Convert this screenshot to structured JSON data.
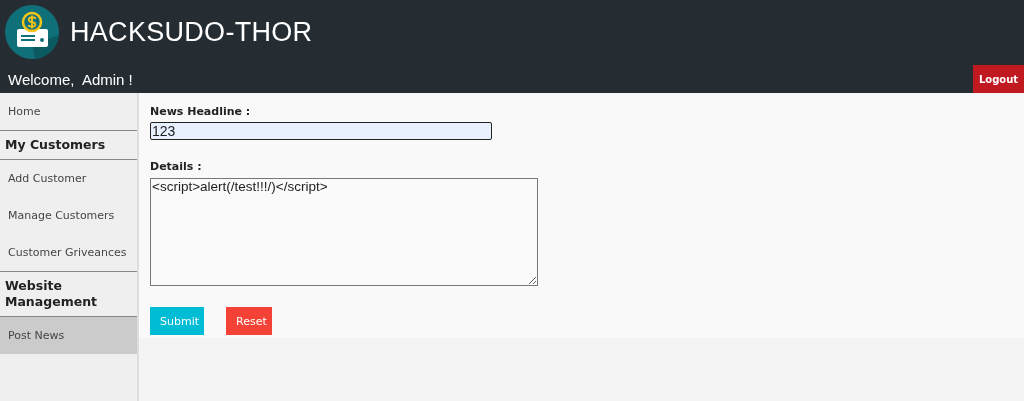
{
  "header": {
    "title": "HACKSUDO-THOR",
    "welcome": "Welcome,  Admin !",
    "logout": "Logout"
  },
  "sidebar": {
    "items": [
      {
        "kind": "link",
        "label": "Home",
        "selected": false
      },
      {
        "kind": "heading",
        "label": "My Customers"
      },
      {
        "kind": "link",
        "label": "Add Customer",
        "selected": false
      },
      {
        "kind": "link",
        "label": "Manage Customers",
        "selected": false
      },
      {
        "kind": "link",
        "label": "Customer Griveances",
        "selected": false
      },
      {
        "kind": "heading",
        "label": "Website Management"
      },
      {
        "kind": "link",
        "label": "Post News",
        "selected": true
      }
    ]
  },
  "form": {
    "headline_label": "News Headline :",
    "headline_value": "123",
    "details_label": "Details :",
    "details_value": "<script>alert(/test!!!/)</script>",
    "buttons": [
      {
        "kind": "submit",
        "label": "Submit"
      },
      {
        "kind": "reset",
        "label": "Reset"
      }
    ]
  }
}
